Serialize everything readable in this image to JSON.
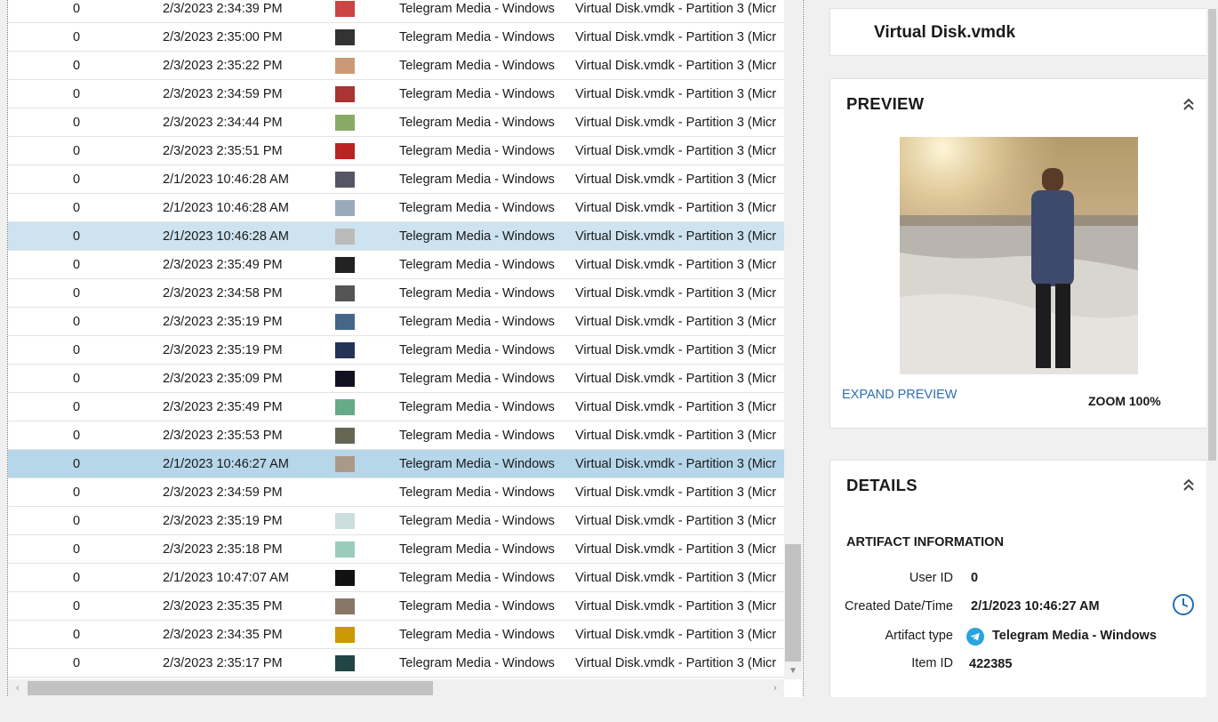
{
  "rows": [
    {
      "user_id": "0",
      "date": "2/3/2023 2:34:39 PM",
      "thumb": "#c44",
      "artifact": "Telegram Media - Windows",
      "source": "Virtual Disk.vmdk - Partition 3 (Micr",
      "state": ""
    },
    {
      "user_id": "0",
      "date": "2/3/2023 2:35:00 PM",
      "thumb": "#333",
      "artifact": "Telegram Media - Windows",
      "source": "Virtual Disk.vmdk - Partition 3 (Micr",
      "state": ""
    },
    {
      "user_id": "0",
      "date": "2/3/2023 2:35:22 PM",
      "thumb": "#c97",
      "artifact": "Telegram Media - Windows",
      "source": "Virtual Disk.vmdk - Partition 3 (Micr",
      "state": ""
    },
    {
      "user_id": "0",
      "date": "2/3/2023 2:34:59 PM",
      "thumb": "#a33",
      "artifact": "Telegram Media - Windows",
      "source": "Virtual Disk.vmdk - Partition 3 (Micr",
      "state": ""
    },
    {
      "user_id": "0",
      "date": "2/3/2023 2:34:44 PM",
      "thumb": "#8a6",
      "artifact": "Telegram Media - Windows",
      "source": "Virtual Disk.vmdk - Partition 3 (Micr",
      "state": ""
    },
    {
      "user_id": "0",
      "date": "2/3/2023 2:35:51 PM",
      "thumb": "#b22",
      "artifact": "Telegram Media - Windows",
      "source": "Virtual Disk.vmdk - Partition 3 (Micr",
      "state": ""
    },
    {
      "user_id": "0",
      "date": "2/1/2023 10:46:28 AM",
      "thumb": "#556",
      "artifact": "Telegram Media - Windows",
      "source": "Virtual Disk.vmdk - Partition 3 (Micr",
      "state": ""
    },
    {
      "user_id": "0",
      "date": "2/1/2023 10:46:28 AM",
      "thumb": "#9ab",
      "artifact": "Telegram Media - Windows",
      "source": "Virtual Disk.vmdk - Partition 3 (Micr",
      "state": ""
    },
    {
      "user_id": "0",
      "date": "2/1/2023 10:46:28 AM",
      "thumb": "#bbb",
      "artifact": "Telegram Media - Windows",
      "source": "Virtual Disk.vmdk - Partition 3 (Micr",
      "state": "hover"
    },
    {
      "user_id": "0",
      "date": "2/3/2023 2:35:49 PM",
      "thumb": "#222",
      "artifact": "Telegram Media - Windows",
      "source": "Virtual Disk.vmdk - Partition 3 (Micr",
      "state": ""
    },
    {
      "user_id": "0",
      "date": "2/3/2023 2:34:58 PM",
      "thumb": "#555",
      "artifact": "Telegram Media - Windows",
      "source": "Virtual Disk.vmdk - Partition 3 (Micr",
      "state": ""
    },
    {
      "user_id": "0",
      "date": "2/3/2023 2:35:19 PM",
      "thumb": "#468",
      "artifact": "Telegram Media - Windows",
      "source": "Virtual Disk.vmdk - Partition 3 (Micr",
      "state": ""
    },
    {
      "user_id": "0",
      "date": "2/3/2023 2:35:19 PM",
      "thumb": "#235",
      "artifact": "Telegram Media - Windows",
      "source": "Virtual Disk.vmdk - Partition 3 (Micr",
      "state": ""
    },
    {
      "user_id": "0",
      "date": "2/3/2023 2:35:09 PM",
      "thumb": "#112",
      "artifact": "Telegram Media - Windows",
      "source": "Virtual Disk.vmdk - Partition 3 (Micr",
      "state": ""
    },
    {
      "user_id": "0",
      "date": "2/3/2023 2:35:49 PM",
      "thumb": "#6a8",
      "artifact": "Telegram Media - Windows",
      "source": "Virtual Disk.vmdk - Partition 3 (Micr",
      "state": ""
    },
    {
      "user_id": "0",
      "date": "2/3/2023 2:35:53 PM",
      "thumb": "#665",
      "artifact": "Telegram Media - Windows",
      "source": "Virtual Disk.vmdk - Partition 3 (Micr",
      "state": ""
    },
    {
      "user_id": "0",
      "date": "2/1/2023 10:46:27 AM",
      "thumb": "#a98",
      "artifact": "Telegram Media - Windows",
      "source": "Virtual Disk.vmdk - Partition 3 (Micr",
      "state": "selected"
    },
    {
      "user_id": "0",
      "date": "2/3/2023 2:34:59 PM",
      "thumb": "",
      "artifact": "Telegram Media - Windows",
      "source": "Virtual Disk.vmdk - Partition 3 (Micr",
      "state": ""
    },
    {
      "user_id": "0",
      "date": "2/3/2023 2:35:19 PM",
      "thumb": "#cdd",
      "artifact": "Telegram Media - Windows",
      "source": "Virtual Disk.vmdk - Partition 3 (Micr",
      "state": ""
    },
    {
      "user_id": "0",
      "date": "2/3/2023 2:35:18 PM",
      "thumb": "#9cb",
      "artifact": "Telegram Media - Windows",
      "source": "Virtual Disk.vmdk - Partition 3 (Micr",
      "state": ""
    },
    {
      "user_id": "0",
      "date": "2/1/2023 10:47:07 AM",
      "thumb": "#111",
      "artifact": "Telegram Media - Windows",
      "source": "Virtual Disk.vmdk - Partition 3 (Micr",
      "state": ""
    },
    {
      "user_id": "0",
      "date": "2/3/2023 2:35:35 PM",
      "thumb": "#876",
      "artifact": "Telegram Media - Windows",
      "source": "Virtual Disk.vmdk - Partition 3 (Micr",
      "state": ""
    },
    {
      "user_id": "0",
      "date": "2/3/2023 2:34:35 PM",
      "thumb": "#c90",
      "artifact": "Telegram Media - Windows",
      "source": "Virtual Disk.vmdk - Partition 3 (Micr",
      "state": ""
    },
    {
      "user_id": "0",
      "date": "2/3/2023 2:35:17 PM",
      "thumb": "#244",
      "artifact": "Telegram Media - Windows",
      "source": "Virtual Disk.vmdk - Partition 3 (Micr",
      "state": ""
    }
  ],
  "panel": {
    "title": "Virtual Disk.vmdk",
    "preview": {
      "heading": "PREVIEW",
      "expand_label": "EXPAND PREVIEW",
      "zoom_label": "ZOOM 100%"
    },
    "details": {
      "heading": "DETAILS",
      "subheading": "ARTIFACT INFORMATION",
      "user_id_label": "User ID",
      "user_id": "0",
      "created_label": "Created Date/Time",
      "created": "2/1/2023 10:46:27 AM",
      "artifact_type_label": "Artifact type",
      "artifact_type": "Telegram Media - Windows",
      "item_id_label": "Item ID",
      "item_id": "422385"
    }
  },
  "icons": {
    "collapse": "chevron-double-up-icon",
    "timeline": "clock-icon",
    "artifact": "telegram-icon"
  },
  "colors": {
    "selected_row": "#b6d6ea",
    "hover_row": "#cde3ef",
    "link": "#2d6fb3",
    "accent": "#1f6fb5"
  }
}
